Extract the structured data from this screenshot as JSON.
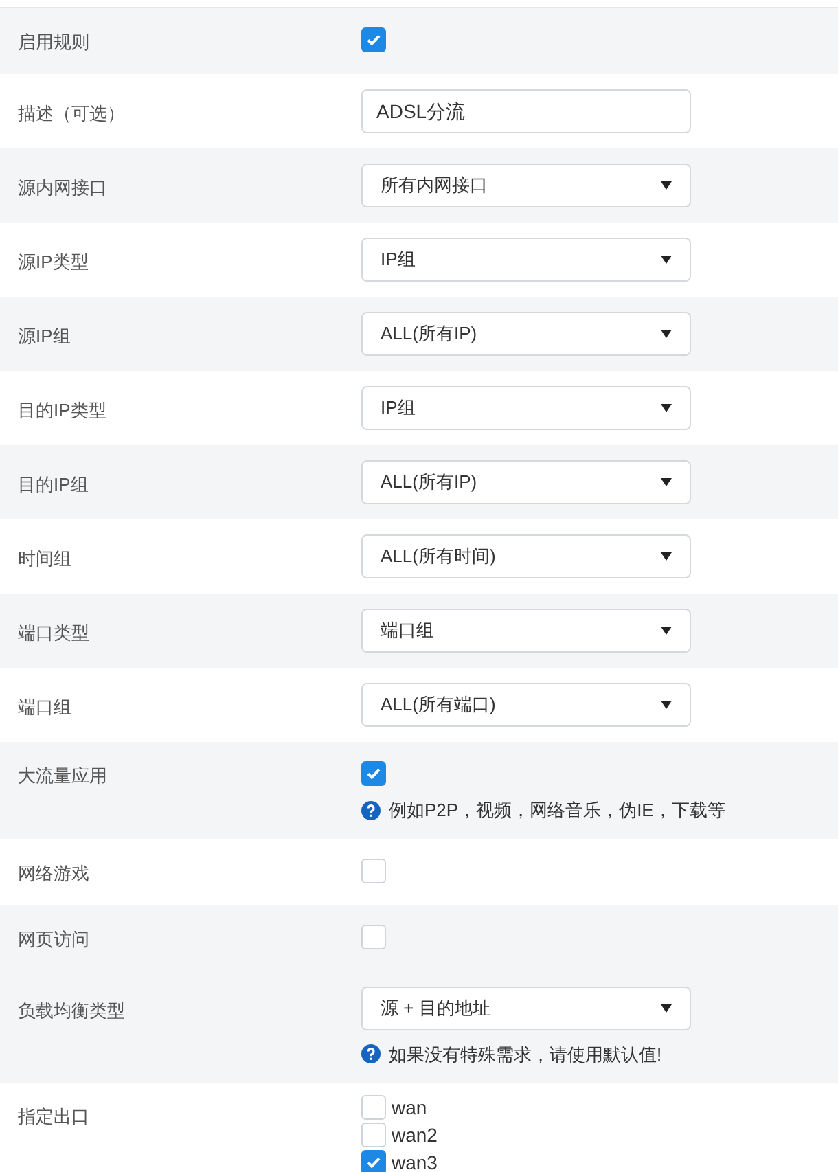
{
  "sections": [
    {
      "rows": [
        {
          "label": "启用规则",
          "kind": "checkbox",
          "checked": true
        }
      ]
    },
    {
      "rows": [
        {
          "label": "描述（可选）",
          "kind": "text",
          "value": "ADSL分流"
        }
      ]
    },
    {
      "rows": [
        {
          "label": "源内网接口",
          "kind": "select",
          "value": "所有内网接口"
        }
      ]
    },
    {
      "rows": [
        {
          "label": "源IP类型",
          "kind": "select",
          "value": "IP组"
        }
      ]
    },
    {
      "rows": [
        {
          "label": "源IP组",
          "kind": "select",
          "value": "ALL(所有IP)"
        }
      ]
    },
    {
      "rows": [
        {
          "label": "目的IP类型",
          "kind": "select",
          "value": "IP组"
        }
      ]
    },
    {
      "rows": [
        {
          "label": "目的IP组",
          "kind": "select",
          "value": "ALL(所有IP)"
        }
      ]
    },
    {
      "rows": [
        {
          "label": "时间组",
          "kind": "select",
          "value": "ALL(所有时间)"
        }
      ]
    },
    {
      "rows": [
        {
          "label": "端口类型",
          "kind": "select",
          "value": "端口组"
        }
      ]
    },
    {
      "rows": [
        {
          "label": "端口组",
          "kind": "select",
          "value": "ALL(所有端口)"
        }
      ]
    },
    {
      "rows": [
        {
          "label": "大流量应用",
          "kind": "checkbox",
          "checked": true,
          "hint": "例如P2P，视频，网络音乐，伪IE，下载等"
        }
      ]
    },
    {
      "rows": [
        {
          "label": "网络游戏",
          "kind": "checkbox",
          "checked": false
        }
      ]
    },
    {
      "rows": [
        {
          "label": "网页访问",
          "kind": "checkbox",
          "checked": false
        },
        {
          "label": "负载均衡类型",
          "kind": "select",
          "value": "源 + 目的地址",
          "hint": "如果没有特殊需求，请使用默认值!"
        }
      ]
    },
    {
      "rows": [
        {
          "label": "指定出口",
          "kind": "checkboxes",
          "options": [
            {
              "label": "wan",
              "checked": false
            },
            {
              "label": "wan2",
              "checked": false
            },
            {
              "label": "wan3",
              "checked": true
            }
          ]
        }
      ]
    }
  ]
}
